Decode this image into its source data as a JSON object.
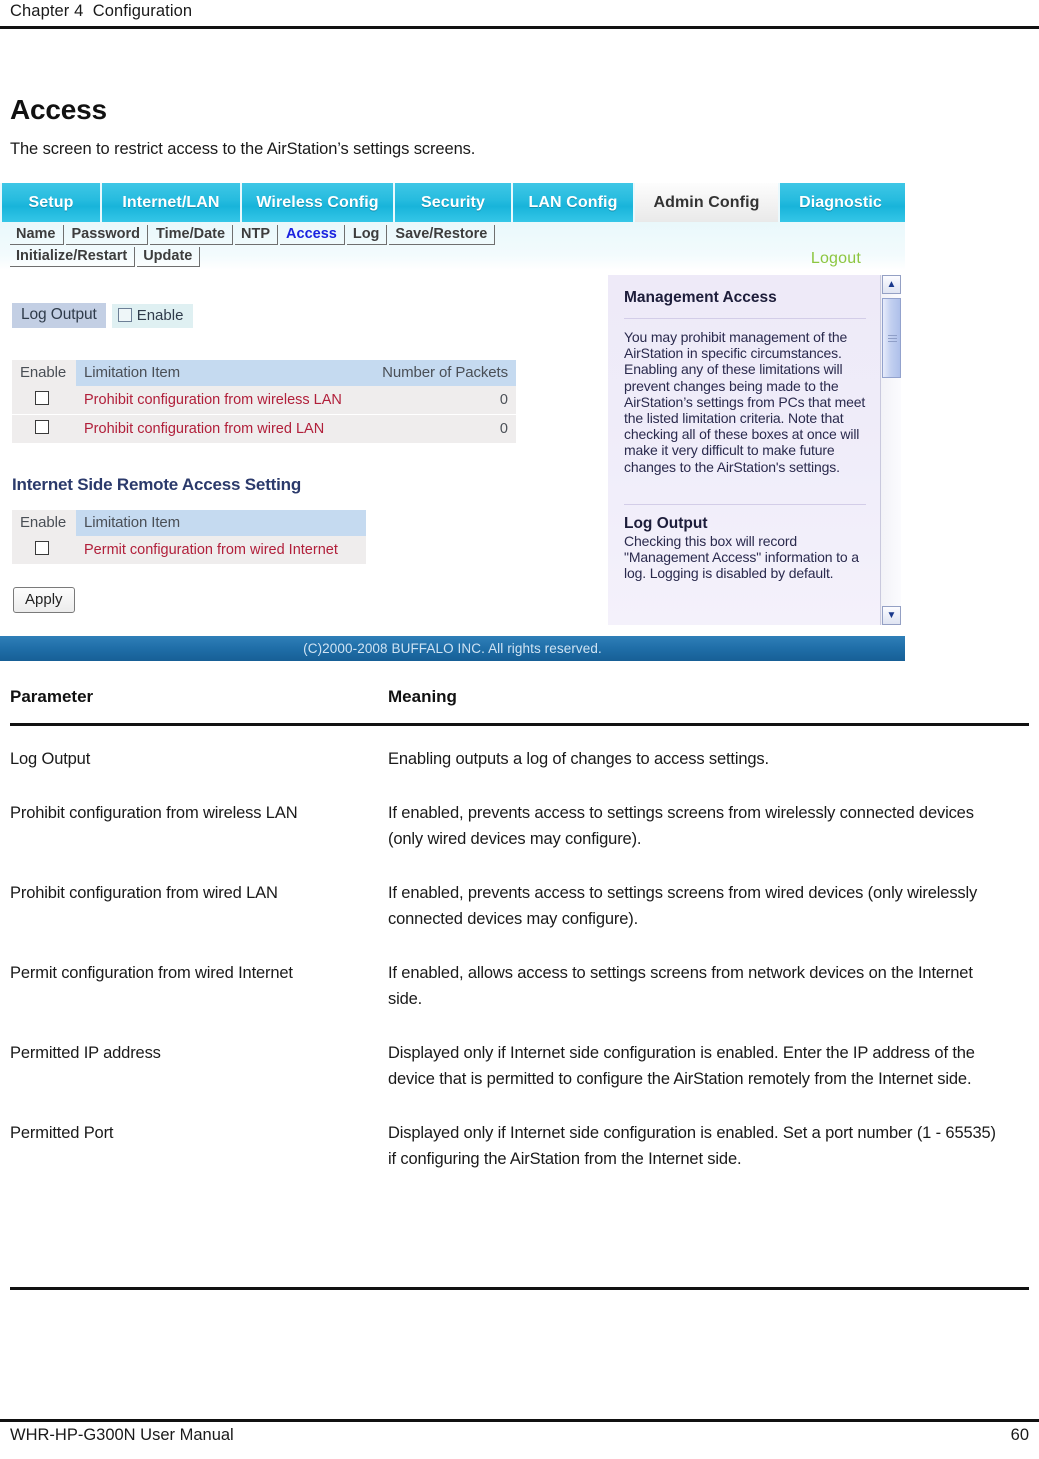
{
  "running_head": "Chapter 4  Configuration",
  "page_title": "Access",
  "page_intro": "The screen to restrict access to the AirStation’s settings screens.",
  "screenshot": {
    "main_tabs": [
      {
        "label": "Setup",
        "active": false
      },
      {
        "label": "Internet/LAN",
        "active": false
      },
      {
        "label": "Wireless Config",
        "active": false
      },
      {
        "label": "Security",
        "active": false
      },
      {
        "label": "LAN Config",
        "active": false
      },
      {
        "label": "Admin Config",
        "active": true
      },
      {
        "label": "Diagnostic",
        "active": false
      }
    ],
    "sub_tabs_row1": [
      {
        "label": "Name",
        "active": false
      },
      {
        "label": "Password",
        "active": false
      },
      {
        "label": "Time/Date",
        "active": false
      },
      {
        "label": "NTP",
        "active": false
      },
      {
        "label": "Access",
        "active": true
      },
      {
        "label": "Log",
        "active": false
      },
      {
        "label": "Save/Restore",
        "active": false
      }
    ],
    "sub_tabs_row2": [
      {
        "label": "Initialize/Restart",
        "active": false
      },
      {
        "label": "Update",
        "active": false
      }
    ],
    "logout_label": "Logout",
    "log_output": {
      "label": "Log Output",
      "checkbox_label": "Enable",
      "checked": false
    },
    "access_table": {
      "headers": {
        "enable": "Enable",
        "item": "Limitation Item",
        "packets": "Number of Packets"
      },
      "rows": [
        {
          "checked": false,
          "item": "Prohibit configuration from wireless LAN",
          "packets": "0"
        },
        {
          "checked": false,
          "item": "Prohibit configuration from wired LAN",
          "packets": "0"
        }
      ]
    },
    "remote_section_title": "Internet Side Remote Access Setting",
    "remote_table": {
      "headers": {
        "enable": "Enable",
        "item": "Limitation Item"
      },
      "rows": [
        {
          "checked": false,
          "item": "Permit configuration from wired Internet"
        }
      ]
    },
    "apply_label": "Apply",
    "help": {
      "management_access_title": "Management Access",
      "management_access_body": "You may prohibit management of the AirStation in specific circumstances. Enabling any of these limitations will prevent changes being made to the AirStation’s settings from PCs that meet the listed limitation criteria. Note that checking all of these boxes at once will make it very difficult to make future changes to the AirStation's settings.",
      "log_output_title": "Log Output",
      "log_output_body": "Checking this box will record \"Management Access\" information to a log. Logging is disabled by default."
    },
    "copyright": "(C)2000-2008 BUFFALO INC. All rights reserved."
  },
  "param_table": {
    "headers": {
      "parameter": "Parameter",
      "meaning": "Meaning"
    },
    "rows": [
      {
        "parameter": "Log Output",
        "meaning": "Enabling outputs a log of changes to access settings."
      },
      {
        "parameter": "Prohibit configuration from wireless LAN",
        "meaning": "If enabled, prevents access to settings screens from wirelessly connected devices (only wired devices may configure)."
      },
      {
        "parameter": "Prohibit configuration from wired LAN",
        "meaning": "If enabled, prevents access to settings screens from wired devices (only wirelessly connected devices may configure)."
      },
      {
        "parameter": "Permit configuration from wired Internet",
        "meaning": "If enabled, allows access to settings screens from network devices on the Internet side."
      },
      {
        "parameter": "Permitted IP address",
        "meaning": "Displayed only if Internet side configuration is enabled. Enter the IP address of the device that is permitted to configure the AirStation remotely from the Internet side."
      },
      {
        "parameter": "Permitted Port",
        "meaning": "Displayed only if Internet side configuration is enabled. Set a port number (1 - 65535) if configuring the AirStation from the Internet side."
      }
    ]
  },
  "footer": {
    "manual": "WHR-HP-G300N User Manual",
    "page_number": "60"
  }
}
